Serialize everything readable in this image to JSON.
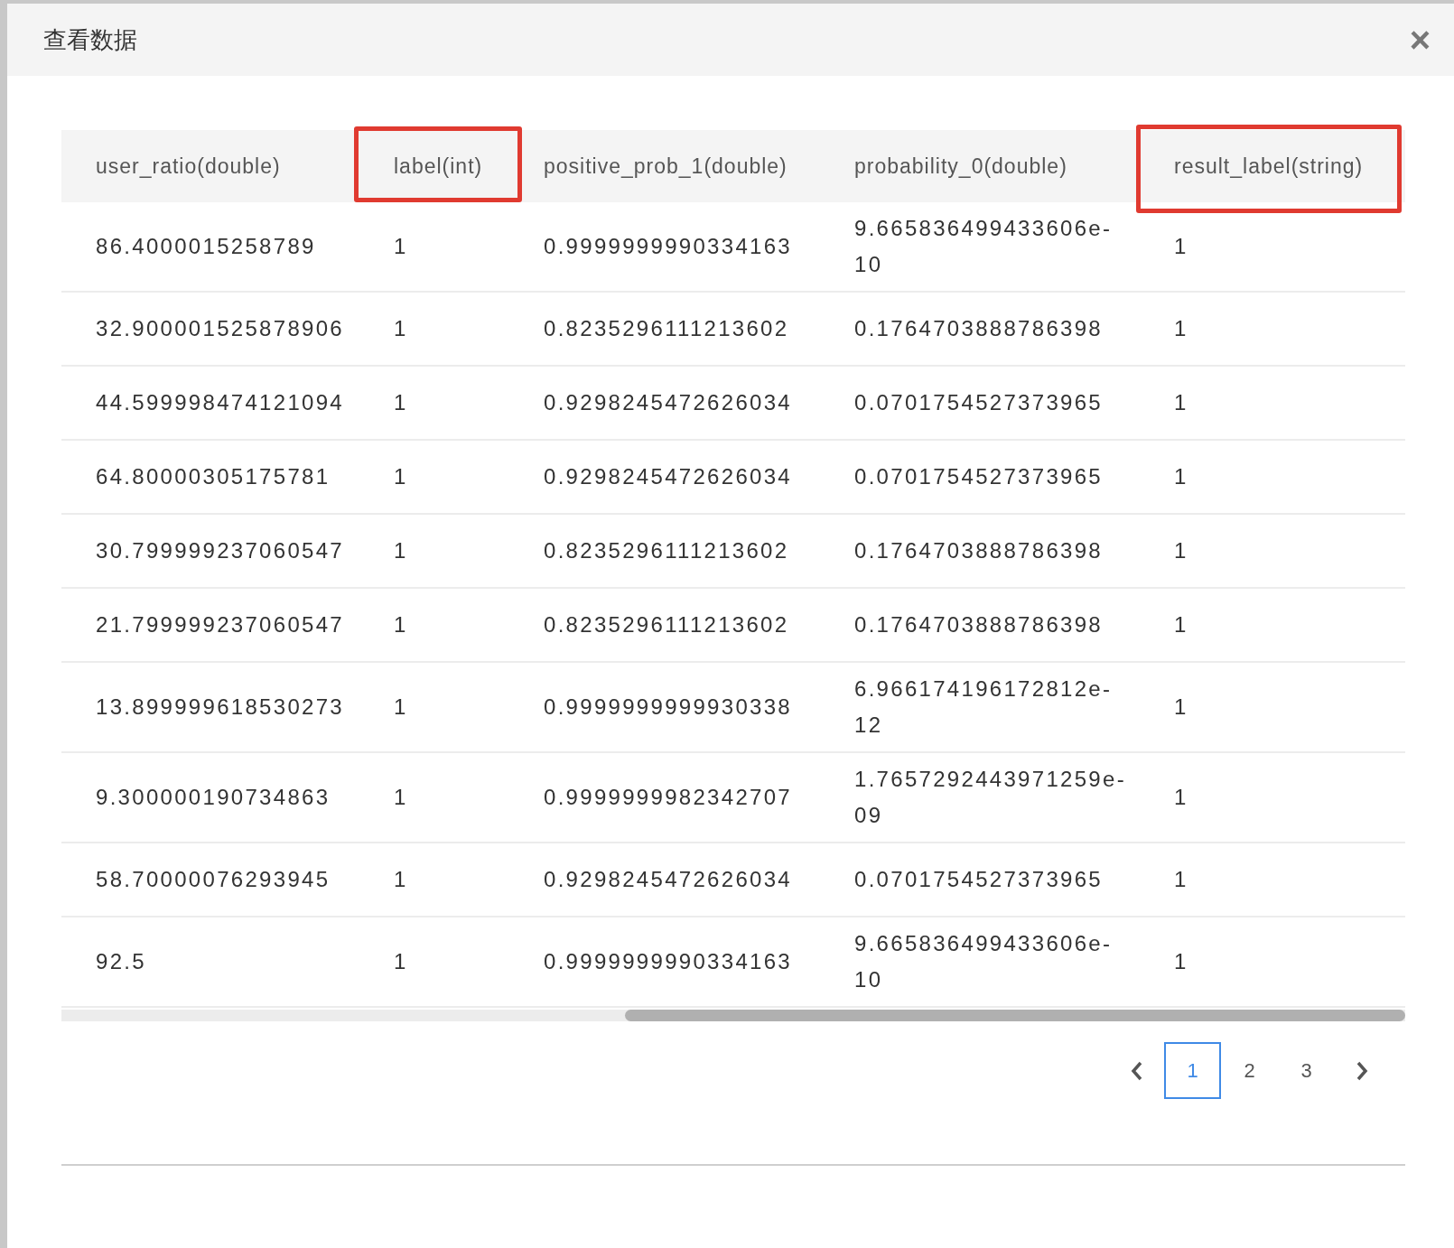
{
  "dialog": {
    "title": "查看数据",
    "close": "×"
  },
  "table": {
    "columns": [
      {
        "label": "user_ratio(double)",
        "highlighted": false
      },
      {
        "label": "label(int)",
        "highlighted": true
      },
      {
        "label": "positive_prob_1(double)",
        "highlighted": false
      },
      {
        "label": "probability_0(double)",
        "highlighted": false
      },
      {
        "label": "result_label(string)",
        "highlighted": true
      }
    ],
    "rows": [
      [
        "86.4000015258789",
        "1",
        "0.9999999990334163",
        "9.665836499433606e-10",
        "1"
      ],
      [
        "32.900001525878906",
        "1",
        "0.8235296111213602",
        "0.1764703888786398",
        "1"
      ],
      [
        "44.599998474121094",
        "1",
        "0.9298245472626034",
        "0.0701754527373965",
        "1"
      ],
      [
        "64.80000305175781",
        "1",
        "0.9298245472626034",
        "0.0701754527373965",
        "1"
      ],
      [
        "30.799999237060547",
        "1",
        "0.8235296111213602",
        "0.1764703888786398",
        "1"
      ],
      [
        "21.799999237060547",
        "1",
        "0.8235296111213602",
        "0.1764703888786398",
        "1"
      ],
      [
        "13.899999618530273",
        "1",
        "0.9999999999930338",
        "6.966174196172812e-12",
        "1"
      ],
      [
        "9.300000190734863",
        "1",
        "0.9999999982342707",
        "1.7657292443971259e-09",
        "1"
      ],
      [
        "58.70000076293945",
        "1",
        "0.9298245472626034",
        "0.0701754527373965",
        "1"
      ],
      [
        "92.5",
        "1",
        "0.9999999990334163",
        "9.665836499433606e-10",
        "1"
      ]
    ]
  },
  "pagination": {
    "pages": [
      {
        "label": "1",
        "selected": true
      },
      {
        "label": "2",
        "selected": false
      },
      {
        "label": "3",
        "selected": false
      }
    ]
  }
}
